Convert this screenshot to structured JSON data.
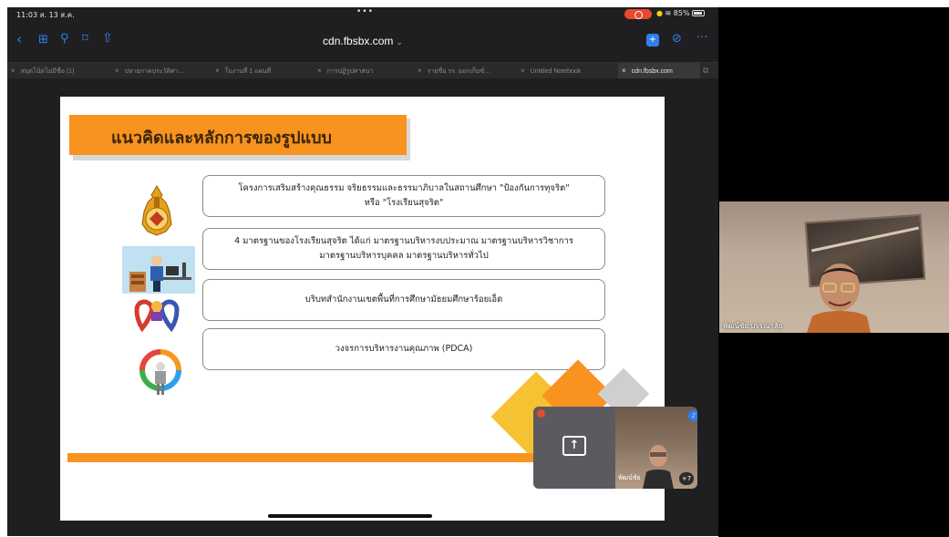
{
  "status_bar": {
    "time": "11:03 ส. 13 ส.ค.",
    "dots": "•••",
    "battery_text": "85%"
  },
  "browser": {
    "url": "cdn.fbsbx.com",
    "tabs": [
      {
        "label": "สมุดโน้ตไม่มีชื่อ (1)",
        "active": false
      },
      {
        "label": "ปลายภาคประวัติศา...",
        "active": false
      },
      {
        "label": "ใบงานที่ 1 แผนที่",
        "active": false
      },
      {
        "label": "การปฏิรูปศาสนา",
        "active": false
      },
      {
        "label": "รายชื่อ รร. ออกเก็บซ์...",
        "active": false
      },
      {
        "label": "Untitled Notebook",
        "active": false
      },
      {
        "label": "cdn.fbsbx.com",
        "active": true
      }
    ],
    "close_glyph": "×",
    "add_glyph": "⧉"
  },
  "slide": {
    "title": "แนวคิดและหลักการของรูปแบบ",
    "rows": [
      {
        "line1": "โครงการเสริมสร้างคุณธรรม จริยธรรมและธรรมาภิบาลในสถานศึกษา \"ป้องกันการทุจริต\"",
        "line2": "หรือ \"โรงเรียนสุจริต\""
      },
      {
        "line1": "4 มาตรฐานของโรงเรียนสุจริต ได้แก่ มาตรฐานบริหารงบประมาณ มาตรฐานบริหารวิชาการ",
        "line2": "มาตรฐานบริหารบุคคล มาตรฐานบริหารทั่วไป"
      },
      {
        "line1": "บริบทสำนักงานเขตพื้นที่การศึกษามัธยมศึกษาร้อยเอ็ด",
        "line2": ""
      },
      {
        "line1": "วงจรการบริหารงานคุณภาพ (PDCA)",
        "line2": ""
      }
    ]
  },
  "pip": {
    "name": "พัฒน์ชัย",
    "plus_count": "+7"
  },
  "video": {
    "participant_name": "พัฒน์ชัย บรรณาลัย"
  },
  "colors": {
    "accent_orange": "#f7931e",
    "ios_blue": "#2f80ed",
    "record_red": "#e8492f"
  }
}
